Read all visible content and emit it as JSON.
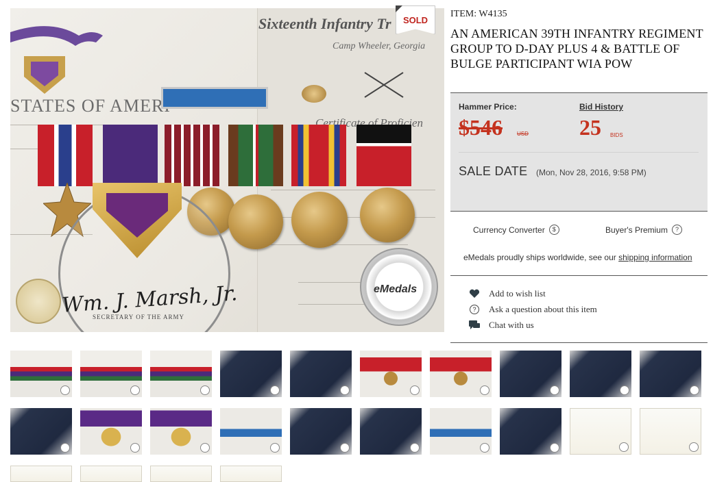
{
  "item": {
    "id_label": "ITEM: W4135",
    "title": "AN AMERICAN 39TH INFANTRY REGIMENT GROUP TO D-DAY PLUS 4 & BATTLE OF BULGE PARTICIPANT WIA POW",
    "sold_badge": "SOLD"
  },
  "photo_text": {
    "cert_left": "STATES OF AMERI",
    "cert_right_title": "Sixteenth Infantry Tr",
    "cert_right_sub": "Camp Wheeler, Georgia",
    "cert_right_cert": "Certificate of Proficien",
    "signature": "Wm. J. Marsh, Jr.",
    "signature_caption": "SECRETARY OF THE ARMY",
    "watermark": "eMedals"
  },
  "price": {
    "hammer_label": "Hammer Price:",
    "hammer_value": "$546",
    "currency": "USD",
    "bid_history_label": "Bid History",
    "bid_count": "25",
    "bids_label": "BIDS",
    "sale_date_label": "SALE DATE",
    "sale_date_value": "(Mon, Nov 28, 2016, 9:58 PM)"
  },
  "tools": {
    "currency_converter": "Currency Converter",
    "currency_icon_glyph": "$",
    "buyers_premium": "Buyer's Premium",
    "buyers_icon_glyph": "?",
    "ship_note_prefix": "eMedals proudly ships worldwide, see our",
    "ship_link": "shipping information"
  },
  "actions": {
    "wish": "Add to wish list",
    "ask": "Ask a question about this item",
    "ask_icon_glyph": "?",
    "chat": "Chat with us"
  },
  "colors": {
    "price_red": "#c4321e",
    "panel_gray": "#e4e4e4",
    "purple_ribbon": "#5a2a86",
    "bronze": "#c49a4c"
  },
  "thumbnails": [
    {
      "subject": "certificate-with-medals",
      "icon": "medal-group"
    },
    {
      "subject": "medal-group-front",
      "icon": "medal-group"
    },
    {
      "subject": "medal-group-reverse",
      "icon": "medal-group"
    },
    {
      "subject": "blue-case-closed",
      "icon": "case"
    },
    {
      "subject": "case-open-medal",
      "icon": "case"
    },
    {
      "subject": "bronze-star-front",
      "icon": "bronze-star"
    },
    {
      "subject": "bronze-star-reverse",
      "icon": "bronze-star"
    },
    {
      "subject": "case-side",
      "icon": "case"
    },
    {
      "subject": "blue-case-closed-2",
      "icon": "case"
    },
    {
      "subject": "purple-heart-case-open",
      "icon": "case"
    },
    {
      "subject": "case-side-2",
      "icon": "case"
    },
    {
      "subject": "purple-heart-front",
      "icon": "purple-heart"
    },
    {
      "subject": "purple-heart-reverse",
      "icon": "purple-heart"
    },
    {
      "subject": "combat-infantry-badge",
      "icon": "badge"
    },
    {
      "subject": "black-case",
      "icon": "case"
    },
    {
      "subject": "boxed-medal",
      "icon": "case"
    },
    {
      "subject": "lapel-pin",
      "icon": "badge"
    },
    {
      "subject": "dark-detail",
      "icon": "case"
    },
    {
      "subject": "purple-heart-certificate",
      "icon": "document"
    },
    {
      "subject": "purple-heart-certificate-2",
      "icon": "document"
    },
    {
      "subject": "document-1",
      "icon": "document"
    },
    {
      "subject": "document-2",
      "icon": "document"
    },
    {
      "subject": "document-3",
      "icon": "document"
    },
    {
      "subject": "document-4",
      "icon": "document"
    }
  ]
}
